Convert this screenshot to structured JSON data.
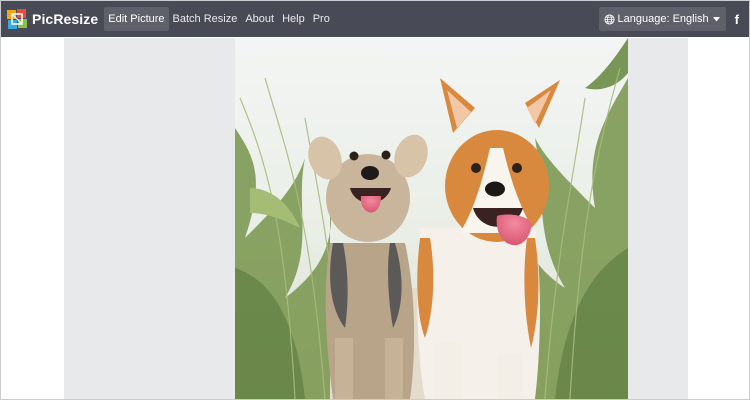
{
  "brand": {
    "name": "PicResize"
  },
  "nav": {
    "items": [
      {
        "label": "Edit Picture",
        "active": true
      },
      {
        "label": "Batch Resize",
        "active": false
      },
      {
        "label": "About",
        "active": false
      },
      {
        "label": "Help",
        "active": false
      },
      {
        "label": "Pro",
        "active": false
      }
    ]
  },
  "language": {
    "label": "Language: English",
    "icon": "globe-icon"
  },
  "social": {
    "facebook": "f",
    "icon": "facebook-icon"
  },
  "colors": {
    "navbar": "#484b55",
    "active_item": "#5e616a",
    "workspace": "#e8e9eb"
  }
}
